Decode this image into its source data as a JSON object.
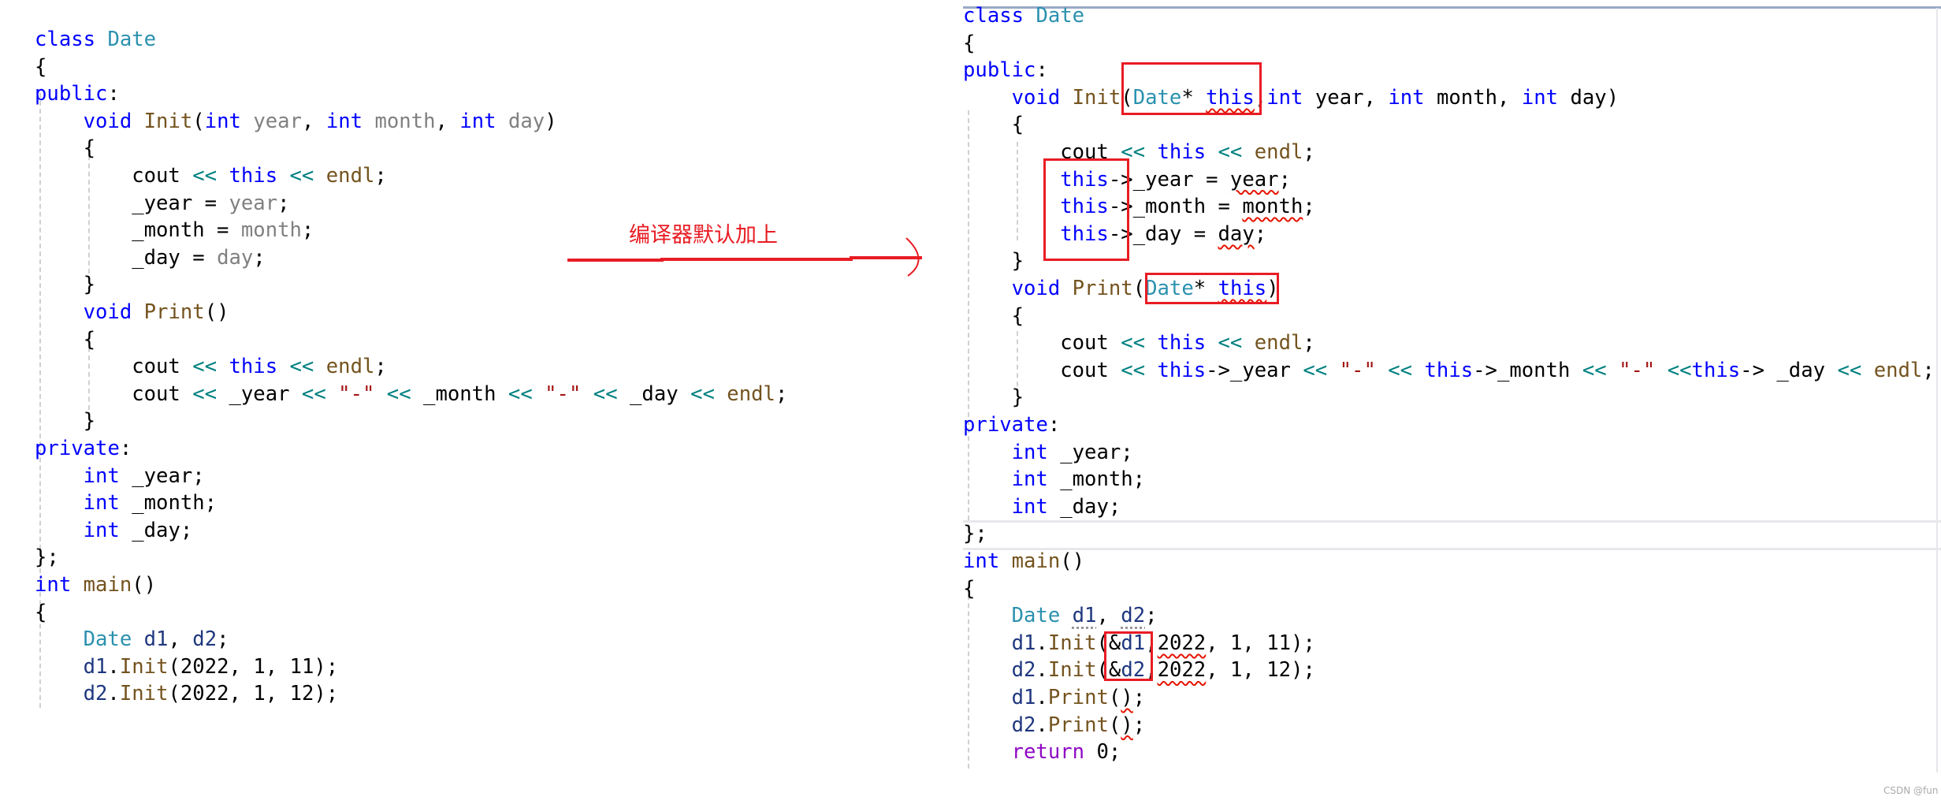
{
  "colors": {
    "keyword": "#0000ff",
    "type": "#2b91af",
    "function": "#74531f",
    "parameter": "#808080",
    "operator": "#008080",
    "string": "#a31515",
    "variable": "#1f377f",
    "control": "#8f08c4",
    "annotation": "#e81c24"
  },
  "annotation": {
    "text": "编译器默认加上",
    "icon": "arrow-right-icon"
  },
  "watermark": "CSDN @fun",
  "left_code": [
    {
      "i": 0,
      "t": [
        [
          "class ",
          "kw"
        ],
        [
          "Date",
          "ty"
        ]
      ]
    },
    {
      "i": 0,
      "t": [
        [
          "{",
          "pl"
        ]
      ]
    },
    {
      "i": 0,
      "t": [
        [
          "public",
          "kw"
        ],
        [
          ":",
          "pl"
        ]
      ]
    },
    {
      "i": 1,
      "t": [
        [
          "void ",
          "kw"
        ],
        [
          "Init",
          "fn"
        ],
        [
          "(",
          "pl"
        ],
        [
          "int ",
          "kw"
        ],
        [
          "year",
          "par"
        ],
        [
          ", ",
          "pl"
        ],
        [
          "int ",
          "kw"
        ],
        [
          "month",
          "par"
        ],
        [
          ", ",
          "pl"
        ],
        [
          "int ",
          "kw"
        ],
        [
          "day",
          "par"
        ],
        [
          ")",
          "pl"
        ]
      ]
    },
    {
      "i": 1,
      "t": [
        [
          "{",
          "pl"
        ]
      ]
    },
    {
      "i": 2,
      "t": [
        [
          "cout ",
          "pl"
        ],
        [
          "<< ",
          "op"
        ],
        [
          "this ",
          "kw"
        ],
        [
          "<< ",
          "op"
        ],
        [
          "endl",
          "fn"
        ],
        [
          ";",
          "pl"
        ]
      ]
    },
    {
      "i": 2,
      "t": [
        [
          "_year = ",
          "pl"
        ],
        [
          "year",
          "par"
        ],
        [
          ";",
          "pl"
        ]
      ]
    },
    {
      "i": 2,
      "t": [
        [
          "_month = ",
          "pl"
        ],
        [
          "month",
          "par"
        ],
        [
          ";",
          "pl"
        ]
      ]
    },
    {
      "i": 2,
      "t": [
        [
          "_day = ",
          "pl"
        ],
        [
          "day",
          "par"
        ],
        [
          ";",
          "pl"
        ]
      ]
    },
    {
      "i": 1,
      "t": [
        [
          "}",
          "pl"
        ]
      ]
    },
    {
      "i": 1,
      "t": [
        [
          "void ",
          "kw"
        ],
        [
          "Print",
          "fn"
        ],
        [
          "()",
          "pl"
        ]
      ]
    },
    {
      "i": 1,
      "t": [
        [
          "{",
          "pl"
        ]
      ]
    },
    {
      "i": 2,
      "t": [
        [
          "cout ",
          "pl"
        ],
        [
          "<< ",
          "op"
        ],
        [
          "this ",
          "kw"
        ],
        [
          "<< ",
          "op"
        ],
        [
          "endl",
          "fn"
        ],
        [
          ";",
          "pl"
        ]
      ]
    },
    {
      "i": 2,
      "t": [
        [
          "cout ",
          "pl"
        ],
        [
          "<< ",
          "op"
        ],
        [
          "_year ",
          "pl"
        ],
        [
          "<< ",
          "op"
        ],
        [
          "\"-\" ",
          "str"
        ],
        [
          "<< ",
          "op"
        ],
        [
          "_month ",
          "pl"
        ],
        [
          "<< ",
          "op"
        ],
        [
          "\"-\" ",
          "str"
        ],
        [
          "<< ",
          "op"
        ],
        [
          "_day ",
          "pl"
        ],
        [
          "<< ",
          "op"
        ],
        [
          "endl",
          "fn"
        ],
        [
          ";",
          "pl"
        ]
      ]
    },
    {
      "i": 1,
      "t": [
        [
          "}",
          "pl"
        ]
      ]
    },
    {
      "i": 0,
      "t": [
        [
          "private",
          "kw"
        ],
        [
          ":",
          "pl"
        ]
      ]
    },
    {
      "i": 1,
      "t": [
        [
          "int ",
          "kw"
        ],
        [
          "_year;",
          "pl"
        ]
      ]
    },
    {
      "i": 1,
      "t": [
        [
          "int ",
          "kw"
        ],
        [
          "_month;",
          "pl"
        ]
      ]
    },
    {
      "i": 1,
      "t": [
        [
          "int ",
          "kw"
        ],
        [
          "_day;",
          "pl"
        ]
      ]
    },
    {
      "i": 0,
      "t": [
        [
          "};",
          "pl"
        ]
      ]
    },
    {
      "i": 0,
      "t": [
        [
          "int ",
          "kw"
        ],
        [
          "main",
          "fn"
        ],
        [
          "()",
          "pl"
        ]
      ]
    },
    {
      "i": 0,
      "t": [
        [
          "{",
          "pl"
        ]
      ]
    },
    {
      "i": 1,
      "t": [
        [
          "Date ",
          "ty"
        ],
        [
          "d1",
          "var"
        ],
        [
          ", ",
          "pl"
        ],
        [
          "d2",
          "var"
        ],
        [
          ";",
          "pl"
        ]
      ]
    },
    {
      "i": 1,
      "t": [
        [
          "d1",
          "var"
        ],
        [
          ".",
          "pl"
        ],
        [
          "Init",
          "fn"
        ],
        [
          "(2022, 1, 11);",
          "pl"
        ]
      ]
    },
    {
      "i": 1,
      "t": [
        [
          "d2",
          "var"
        ],
        [
          ".",
          "pl"
        ],
        [
          "Init",
          "fn"
        ],
        [
          "(2022, 1, 12);",
          "pl"
        ]
      ]
    }
  ],
  "right_code": [
    {
      "i": 0,
      "t": [
        [
          "class ",
          "kw"
        ],
        [
          "Date",
          "ty"
        ]
      ]
    },
    {
      "i": 0,
      "t": [
        [
          "{",
          "pl"
        ]
      ]
    },
    {
      "i": 0,
      "t": [
        [
          "public",
          "kw"
        ],
        [
          ":",
          "pl"
        ]
      ]
    },
    {
      "i": 1,
      "t": [
        [
          "void ",
          "kw"
        ],
        [
          "Init",
          "fn"
        ],
        [
          "(",
          "pl"
        ],
        [
          "Date",
          "ty"
        ],
        [
          "* ",
          "pl"
        ],
        [
          "this",
          "kw",
          "sq"
        ],
        [
          ",",
          "pl"
        ],
        [
          "int ",
          "kw"
        ],
        [
          "year, ",
          "pl"
        ],
        [
          "int ",
          "kw"
        ],
        [
          "month, ",
          "pl"
        ],
        [
          "int ",
          "kw"
        ],
        [
          "day)",
          "pl"
        ]
      ]
    },
    {
      "i": 1,
      "t": [
        [
          "{",
          "pl"
        ]
      ]
    },
    {
      "i": 2,
      "t": [
        [
          "cout ",
          "pl"
        ],
        [
          "<< ",
          "op"
        ],
        [
          "this ",
          "kw"
        ],
        [
          "<< ",
          "op"
        ],
        [
          "endl",
          "fn"
        ],
        [
          ";",
          "pl"
        ]
      ]
    },
    {
      "i": 2,
      "t": [
        [
          "this",
          "kw"
        ],
        [
          "->_year = ",
          "pl"
        ],
        [
          "year",
          "pl",
          "sq"
        ],
        [
          ";",
          "pl"
        ]
      ]
    },
    {
      "i": 2,
      "t": [
        [
          "this",
          "kw"
        ],
        [
          "->_month = ",
          "pl"
        ],
        [
          "month",
          "pl",
          "sq"
        ],
        [
          ";",
          "pl"
        ]
      ]
    },
    {
      "i": 2,
      "t": [
        [
          "this",
          "kw"
        ],
        [
          "->_day = ",
          "pl"
        ],
        [
          "day",
          "pl",
          "sq"
        ],
        [
          ";",
          "pl"
        ]
      ]
    },
    {
      "i": 1,
      "t": [
        [
          "}",
          "pl"
        ]
      ]
    },
    {
      "i": 1,
      "t": [
        [
          "void ",
          "kw"
        ],
        [
          "Print",
          "fn"
        ],
        [
          "(",
          "pl"
        ],
        [
          "Date",
          "ty"
        ],
        [
          "* ",
          "pl"
        ],
        [
          "this",
          "kw",
          "sq"
        ],
        [
          ")",
          "pl"
        ]
      ]
    },
    {
      "i": 1,
      "t": [
        [
          "{",
          "pl"
        ]
      ]
    },
    {
      "i": 2,
      "t": [
        [
          "cout ",
          "pl"
        ],
        [
          "<< ",
          "op"
        ],
        [
          "this ",
          "kw"
        ],
        [
          "<< ",
          "op"
        ],
        [
          "endl",
          "fn"
        ],
        [
          ";",
          "pl"
        ]
      ]
    },
    {
      "i": 2,
      "t": [
        [
          "cout ",
          "pl"
        ],
        [
          "<< ",
          "op"
        ],
        [
          "this",
          "kw"
        ],
        [
          "->_year ",
          "pl"
        ],
        [
          "<< ",
          "op"
        ],
        [
          "\"-\" ",
          "str"
        ],
        [
          "<< ",
          "op"
        ],
        [
          "this",
          "kw"
        ],
        [
          "->_month ",
          "pl"
        ],
        [
          "<< ",
          "op"
        ],
        [
          "\"-\" ",
          "str"
        ],
        [
          "<<",
          "op"
        ],
        [
          "this",
          "kw"
        ],
        [
          "-> _day ",
          "pl"
        ],
        [
          "<< ",
          "op"
        ],
        [
          "endl",
          "fn"
        ],
        [
          ";",
          "pl"
        ]
      ]
    },
    {
      "i": 1,
      "t": [
        [
          "}",
          "pl"
        ]
      ]
    },
    {
      "i": 0,
      "t": [
        [
          "private",
          "kw"
        ],
        [
          ":",
          "pl"
        ]
      ]
    },
    {
      "i": 1,
      "t": [
        [
          "int ",
          "kw"
        ],
        [
          "_year;",
          "pl"
        ]
      ]
    },
    {
      "i": 1,
      "t": [
        [
          "int ",
          "kw"
        ],
        [
          "_month;",
          "pl"
        ]
      ]
    },
    {
      "i": 1,
      "t": [
        [
          "int ",
          "kw"
        ],
        [
          "_day;",
          "pl"
        ]
      ]
    },
    {
      "i": 0,
      "t": [
        [
          "};",
          "pl"
        ]
      ]
    },
    {
      "i": 0,
      "t": [
        [
          "int ",
          "kw"
        ],
        [
          "main",
          "fn"
        ],
        [
          "()",
          "pl"
        ]
      ]
    },
    {
      "i": 0,
      "t": [
        [
          "{",
          "pl"
        ]
      ]
    },
    {
      "i": 1,
      "t": [
        [
          "Date ",
          "ty"
        ],
        [
          "d1",
          "var",
          "dt"
        ],
        [
          ", ",
          "pl"
        ],
        [
          "d2",
          "var",
          "dt"
        ],
        [
          ";",
          "pl"
        ]
      ]
    },
    {
      "i": 1,
      "t": [
        [
          "d1",
          "var"
        ],
        [
          ".",
          "pl"
        ],
        [
          "Init",
          "fn"
        ],
        [
          "(&",
          "pl"
        ],
        [
          "d1",
          "var"
        ],
        [
          ",",
          "pl"
        ],
        [
          "2022",
          "pl",
          "sq"
        ],
        [
          ", 1, 11);",
          "pl"
        ]
      ]
    },
    {
      "i": 1,
      "t": [
        [
          "d2",
          "var"
        ],
        [
          ".",
          "pl"
        ],
        [
          "Init",
          "fn"
        ],
        [
          "(&",
          "pl"
        ],
        [
          "d2",
          "var"
        ],
        [
          ",",
          "pl"
        ],
        [
          "2022",
          "pl",
          "sq"
        ],
        [
          ", 1, 12);",
          "pl"
        ]
      ]
    },
    {
      "i": 1,
      "t": [
        [
          "d1",
          "var"
        ],
        [
          ".",
          "pl"
        ],
        [
          "Print",
          "fn"
        ],
        [
          "(",
          "pl"
        ],
        [
          ")",
          "pl",
          "sq"
        ],
        [
          ";",
          "pl"
        ]
      ]
    },
    {
      "i": 1,
      "t": [
        [
          "d2",
          "var"
        ],
        [
          ".",
          "pl"
        ],
        [
          "Print",
          "fn"
        ],
        [
          "(",
          "pl"
        ],
        [
          ")",
          "pl",
          "sq"
        ],
        [
          ";",
          "pl"
        ]
      ]
    },
    {
      "i": 1,
      "t": [
        [
          "return ",
          "ret"
        ],
        [
          "0;",
          "pl"
        ]
      ]
    }
  ]
}
